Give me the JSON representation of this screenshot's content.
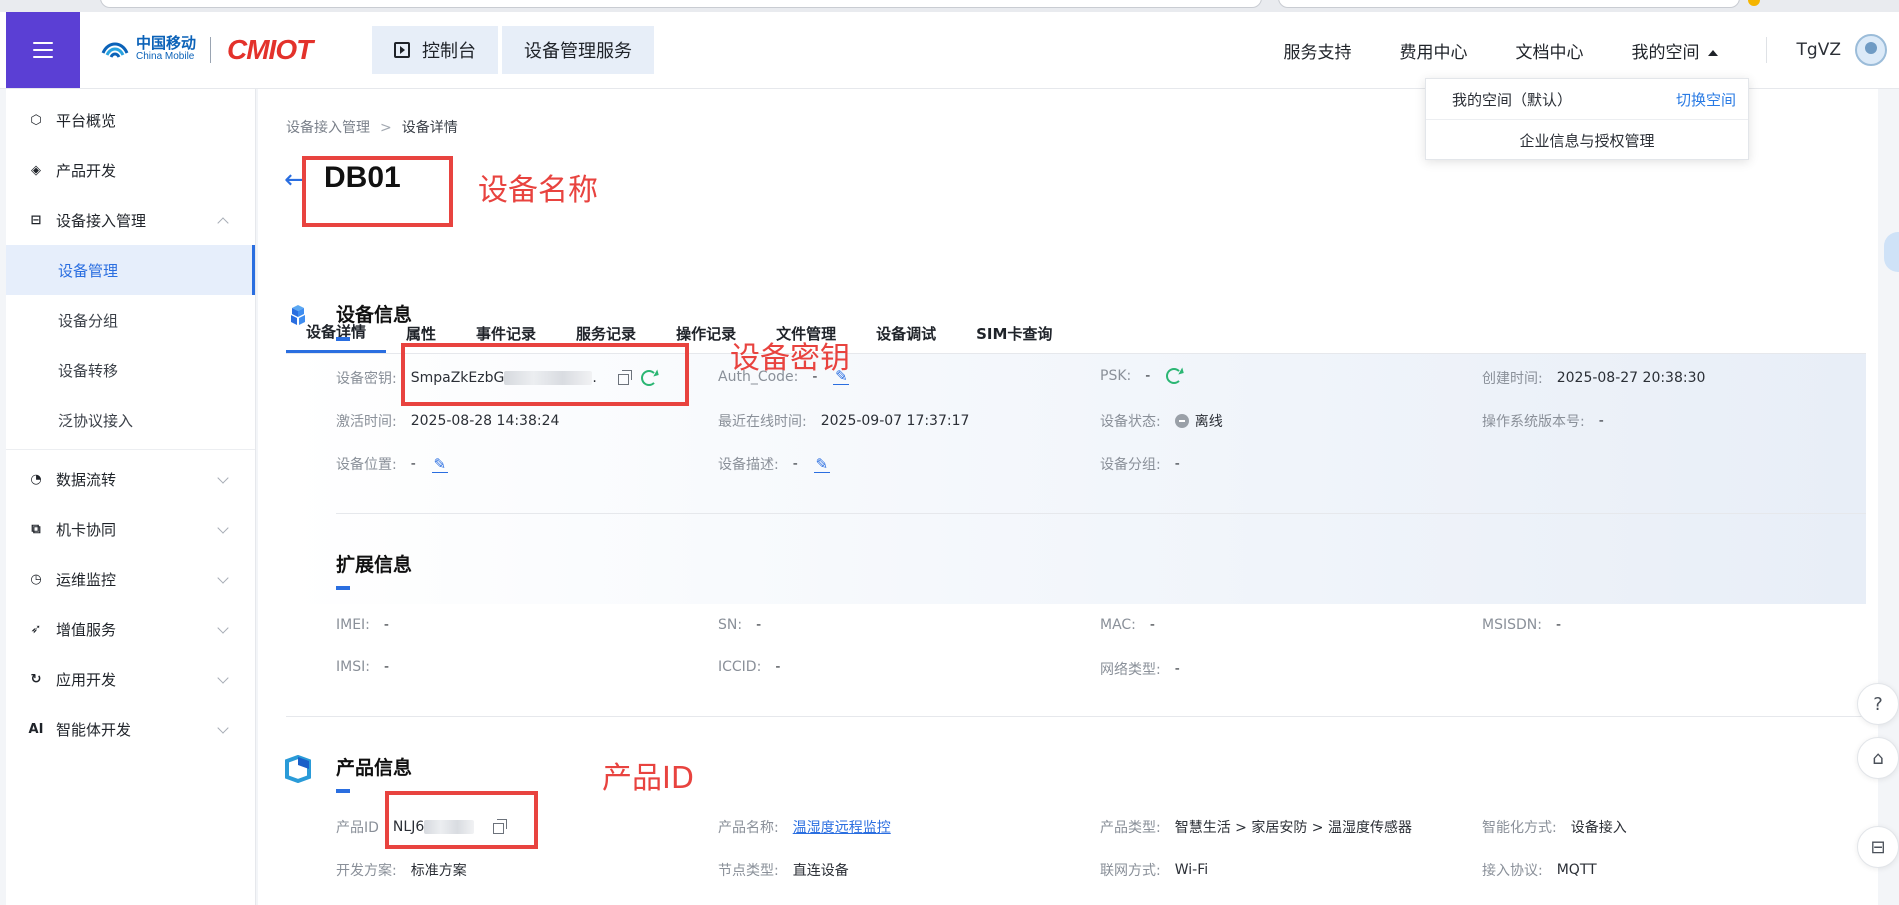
{
  "header": {
    "logo_cn": "中国移动",
    "logo_en": "China Mobile",
    "logo_brand": "CMIOT",
    "tabs": [
      {
        "label": "控制台"
      },
      {
        "label": "设备管理服务"
      }
    ],
    "nav": [
      "服务支持",
      "费用中心",
      "文档中心",
      "我的空间"
    ],
    "username": "TgVZ"
  },
  "dropdown": {
    "space_default": "我的空间（默认）",
    "switch_label": "切换空间",
    "enterprise_label": "企业信息与授权管理"
  },
  "sidebar": {
    "items": [
      {
        "label": "平台概览",
        "icon": "platform-overview-icon"
      },
      {
        "label": "产品开发",
        "icon": "product-dev-icon"
      },
      {
        "label": "设备接入管理",
        "icon": "device-access-icon",
        "expanded": true
      }
    ],
    "subitems": [
      {
        "label": "设备管理",
        "active": true
      },
      {
        "label": "设备分组"
      },
      {
        "label": "设备转移"
      },
      {
        "label": "泛协议接入"
      }
    ],
    "items2": [
      {
        "label": "数据流转",
        "icon": "data-flow-icon"
      },
      {
        "label": "机卡协同",
        "icon": "card-sync-icon"
      },
      {
        "label": "运维监控",
        "icon": "monitor-icon"
      },
      {
        "label": "增值服务",
        "icon": "value-added-icon"
      },
      {
        "label": "应用开发",
        "icon": "app-dev-icon"
      },
      {
        "label": "智能体开发",
        "icon": "ai-agent-icon",
        "glyph": "AI"
      }
    ]
  },
  "breadcrumb": {
    "parent": "设备接入管理",
    "sep": ">",
    "current": "设备详情"
  },
  "device": {
    "name": "DB01"
  },
  "annotations": {
    "device_name": "设备名称",
    "device_key": "设备密钥",
    "product_id": "产品ID"
  },
  "tabs": [
    "设备详情",
    "属性",
    "事件记录",
    "服务记录",
    "操作记录",
    "文件管理",
    "设备调试",
    "SIM卡查询"
  ],
  "device_info": {
    "title": "设备信息",
    "key_label": "设备密钥:",
    "key_value": "SmpaZkEzbG",
    "auth_label": "Auth_Code:",
    "auth_value": "-",
    "psk_label": "PSK:",
    "psk_value": "-",
    "created_label": "创建时间:",
    "created_value": "2025-08-27 20:38:30",
    "activated_label": "激活时间:",
    "activated_value": "2025-08-28 14:38:24",
    "last_online_label": "最近在线时间:",
    "last_online_value": "2025-09-07 17:37:17",
    "status_label": "设备状态:",
    "status_value": "离线",
    "os_label": "操作系统版本号:",
    "os_value": "-",
    "location_label": "设备位置:",
    "location_value": "-",
    "desc_label": "设备描述:",
    "desc_value": "-",
    "group_label": "设备分组:",
    "group_value": "-"
  },
  "ext_info": {
    "title": "扩展信息",
    "imei_label": "IMEI:",
    "imei_value": "-",
    "sn_label": "SN:",
    "sn_value": "-",
    "mac_label": "MAC:",
    "mac_value": "-",
    "msisdn_label": "MSISDN:",
    "msisdn_value": "-",
    "imsi_label": "IMSI:",
    "imsi_value": "-",
    "iccid_label": "ICCID:",
    "iccid_value": "-",
    "net_label": "网络类型:",
    "net_value": "-"
  },
  "product_info": {
    "title": "产品信息",
    "id_label": "产品ID",
    "id_value": "NLJ6",
    "name_label": "产品名称:",
    "name_value": "温湿度远程监控",
    "type_label": "产品类型:",
    "type_value": "智慧生活 > 家居安防 > 温湿度传感器",
    "smart_label": "智能化方式:",
    "smart_value": "设备接入",
    "plan_label": "开发方案:",
    "plan_value": "标准方案",
    "node_label": "节点类型:",
    "node_value": "直连设备",
    "network_label": "联网方式:",
    "network_value": "Wi-Fi",
    "protocol_label": "接入协议:",
    "protocol_value": "MQTT"
  },
  "colors": {
    "accent": "#2a6ee0",
    "menu_bg": "#5b3fd4",
    "annotation": "#e8433f",
    "online_green": "#2bb673"
  }
}
